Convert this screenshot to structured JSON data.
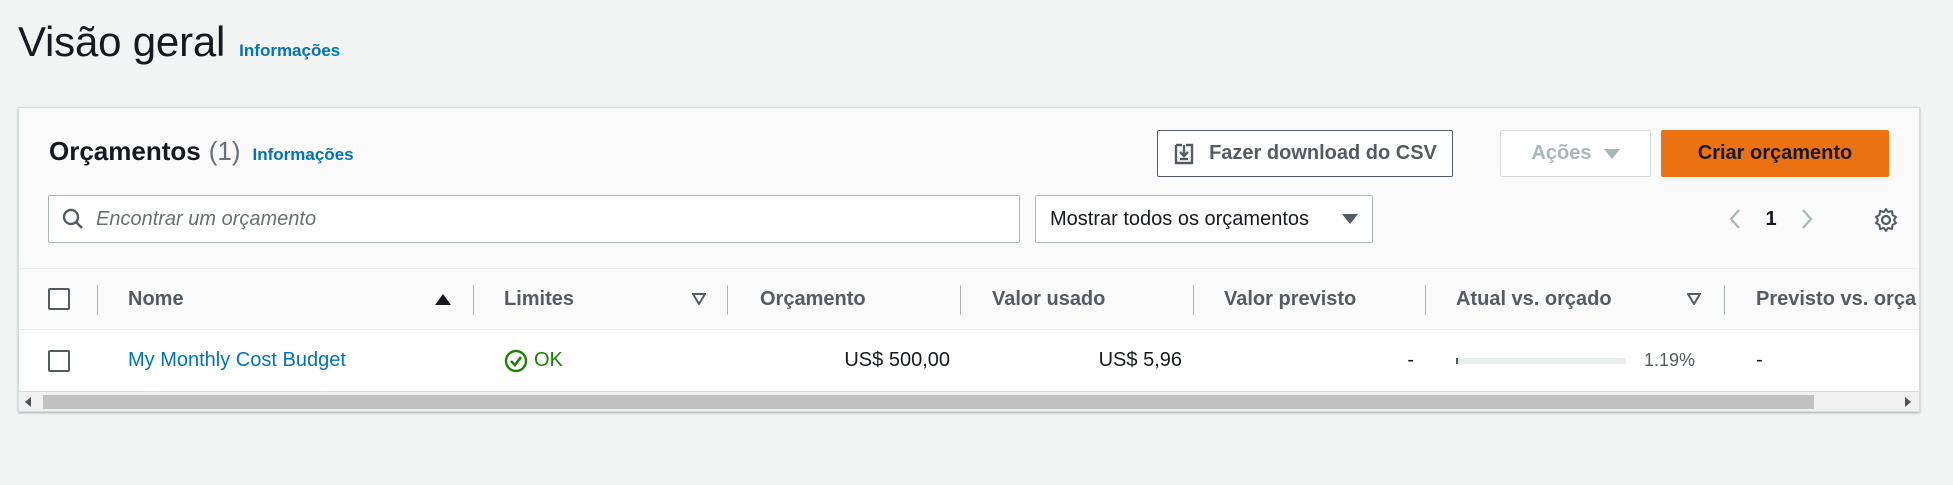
{
  "page": {
    "title": "Visão geral",
    "info_link": "Informações"
  },
  "budgets": {
    "title": "Orçamentos",
    "count": "(1)",
    "info_link": "Informações",
    "download_csv_label": "Fazer download do CSV",
    "actions_label": "Ações",
    "create_label": "Criar orçamento",
    "search_placeholder": "Encontrar um orçamento",
    "filter_selected": "Mostrar todos os orçamentos",
    "page_number": "1"
  },
  "table": {
    "columns": {
      "name": "Nome",
      "limits": "Limites",
      "budget": "Orçamento",
      "used": "Valor usado",
      "forecast": "Valor previsto",
      "actual_vs_budget": "Atual vs. orçado",
      "forecast_vs_budget": "Previsto vs. orça"
    },
    "rows": [
      {
        "name": "My Monthly Cost Budget",
        "limits": "OK",
        "budget": "US$ 500,00",
        "used": "US$ 5,96",
        "forecast": "-",
        "actual_vs_budget_pct": "1.19%",
        "actual_vs_budget_fraction": 0.0119,
        "forecast_vs_budget": "-"
      }
    ]
  },
  "colors": {
    "primary_button": "#ec7211",
    "link": "#0073bb",
    "ok_status": "#1d8102"
  },
  "icons": [
    "download-icon",
    "caret-down-icon",
    "search-icon",
    "chevron-left-icon",
    "chevron-right-icon",
    "gear-icon",
    "sort-ascending-icon",
    "sort-icon",
    "status-ok-icon"
  ]
}
